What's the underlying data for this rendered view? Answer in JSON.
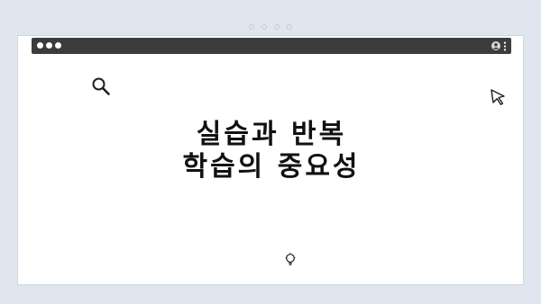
{
  "pager": {
    "dot_count": 4
  },
  "window": {
    "titlebar_color": "#3a3c3e",
    "icons": [
      "profile-icon",
      "more-vert-icon"
    ]
  },
  "content": {
    "title_line_1": "실습과 반복",
    "title_line_2": "학습의 중요성",
    "icons": [
      "search-icon",
      "cursor-icon",
      "lightbulb-icon"
    ]
  },
  "colors": {
    "background": "#dfe6ed",
    "window": "#ffffff",
    "text": "#111111"
  }
}
